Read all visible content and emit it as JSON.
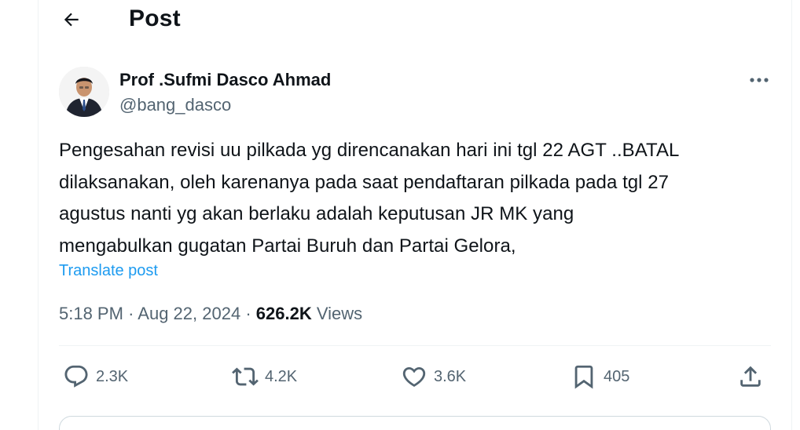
{
  "header": {
    "title": "Post",
    "back_icon": "arrow-left-icon"
  },
  "author": {
    "name": "Prof .Sufmi Dasco Ahmad",
    "handle": "@bang_dasco",
    "more_icon": "more-horizontal-icon"
  },
  "post": {
    "lines": [
      "Pengesahan revisi uu pilkada yg direncanakan hari ini  tgl 22 AGT ..BATAL",
      "dilaksanakan, oleh karenanya pada saat pendaftaran pilkada pada tgl 27",
      "agustus nanti yg akan berlaku adalah keputusan JR  MK yang",
      "mengabulkan gugatan Partai Buruh dan Partai Gelora,"
    ],
    "translate_label": "Translate post",
    "time": "5:18 PM",
    "separator": "·",
    "date": "Aug 22, 2024",
    "views_count": "626.2K",
    "views_label": "Views"
  },
  "actions": {
    "reply": {
      "count": "2.3K",
      "icon": "reply-bubble-icon"
    },
    "repost": {
      "count": "4.2K",
      "icon": "repost-icon"
    },
    "like": {
      "count": "3.6K",
      "icon": "heart-icon"
    },
    "bookmark": {
      "count": "405",
      "icon": "bookmark-icon"
    },
    "share": {
      "icon": "share-icon"
    }
  },
  "colors": {
    "text": "#0f1419",
    "secondary": "#536471",
    "link": "#1d9bf0",
    "border": "#eff3f4"
  }
}
